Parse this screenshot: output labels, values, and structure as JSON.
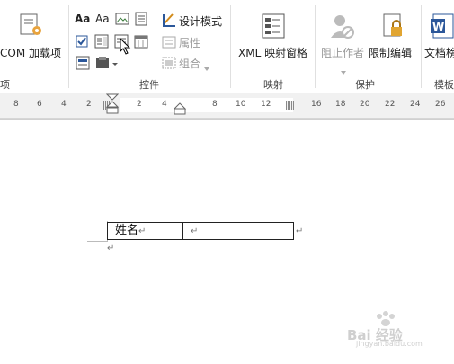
{
  "ribbon": {
    "com_addin_label": "COM 加载项",
    "group_left_partial": "项",
    "controls_group_label": "控件",
    "aa_text": "Aa",
    "aa_plain": "Aa",
    "design_mode_label": "设计模式",
    "properties_label": "属性",
    "group_label": "组合",
    "xml_label": "XML 映射窗格",
    "mapping_group_label": "映射",
    "block_author_label": "阻止作者",
    "restrict_editing_label": "限制编辑",
    "protect_group_label": "保护",
    "doc_template_label": "文档榜",
    "template_group_label": "模板"
  },
  "ruler": {
    "left_numbers": [
      "8",
      "6",
      "4",
      "2"
    ],
    "inner_numbers": [
      "2",
      "4"
    ],
    "right_numbers": [
      "8",
      "10",
      "12",
      "16",
      "18",
      "20",
      "22",
      "24",
      "26"
    ]
  },
  "document": {
    "table": {
      "name_cell": "姓名",
      "paragraph_mark": "↵"
    }
  },
  "watermark": {
    "text": "Bai 经验",
    "sub": "jingyan.baidu.com"
  },
  "colors": {
    "accent": "#2b579a",
    "disabled": "#9a9a9a",
    "word_blue": "#2b579a"
  }
}
